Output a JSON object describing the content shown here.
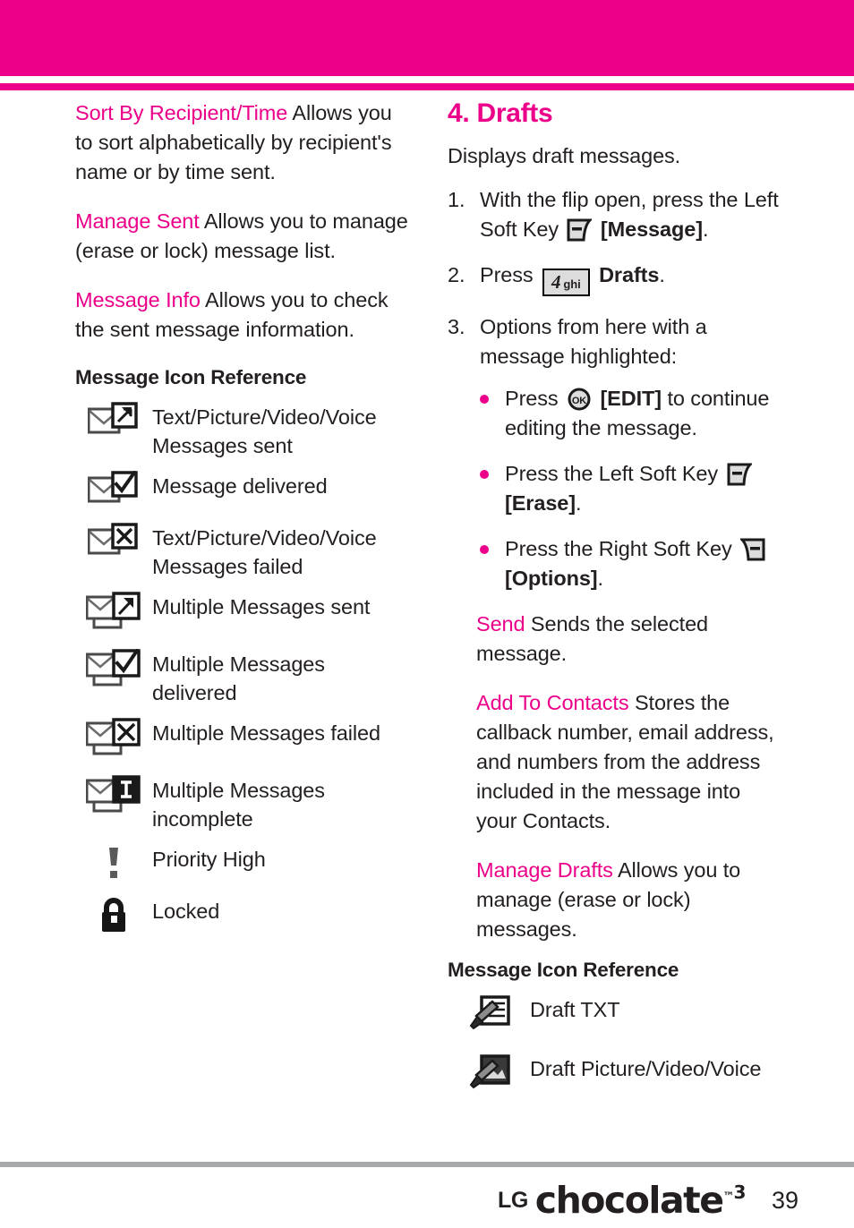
{
  "theme": {
    "accent": "#ec0089",
    "text": "#231f20",
    "rule": "#a7a9ac",
    "key_fill": "#dcdcdc"
  },
  "header": {
    "band": "magenta-band",
    "stripe": "magenta-stripe"
  },
  "left_column": {
    "paragraphs": [
      {
        "term": "Sort By Recipient/Time",
        "body": "Allows you to sort alphabetically by recipient's name or by time sent."
      },
      {
        "term": "Manage Sent",
        "body": "Allows you to manage (erase or lock) message list."
      },
      {
        "term": "Message Info",
        "body": "Allows you to check the sent message information."
      }
    ],
    "icon_reference": {
      "title": "Message Icon Reference",
      "items": [
        {
          "icon": "message-sent-icon",
          "label": "Text/Picture/Video/Voice Messages sent"
        },
        {
          "icon": "message-delivered-icon",
          "label": "Message delivered"
        },
        {
          "icon": "message-failed-icon",
          "label": "Text/Picture/Video/Voice Messages failed"
        },
        {
          "icon": "multiple-messages-sent-icon",
          "label": "Multiple Messages sent"
        },
        {
          "icon": "multiple-messages-delivered-icon",
          "label": "Multiple Messages delivered"
        },
        {
          "icon": "multiple-messages-failed-icon",
          "label": "Multiple Messages failed"
        },
        {
          "icon": "multiple-messages-incomplete-icon",
          "label": "Multiple Messages incomplete"
        },
        {
          "icon": "priority-high-icon",
          "label": "Priority High"
        },
        {
          "icon": "locked-icon",
          "label": "Locked"
        }
      ]
    }
  },
  "right_column": {
    "chapter_title": "4. Drafts",
    "intro": "Displays draft messages.",
    "steps": [
      {
        "num": "1.",
        "pre": "With the flip open, press the Left Soft Key",
        "key_icon": "left-soft-key-icon",
        "post": "[Message]",
        "post_tail": "."
      },
      {
        "num": "2.",
        "pre": "Press",
        "key_icon": "numeric-key-4-ghi",
        "key_digit": "4",
        "key_sub": "ghi",
        "post": "Drafts",
        "post_tail": "."
      },
      {
        "num": "3.",
        "pre": "Options from here with a message highlighted:",
        "key_icon": "",
        "post": "",
        "post_tail": ""
      }
    ],
    "bullets": [
      {
        "pre": "Press",
        "key_icon": "ok-key-icon",
        "mid": "[EDIT]",
        "post": "to continue editing the message."
      },
      {
        "pre": "Press the Left Soft Key",
        "key_icon": "left-soft-key-icon",
        "mid": "[Erase]",
        "post": "."
      },
      {
        "pre": "Press the Right Soft Key",
        "key_icon": "right-soft-key-icon",
        "mid": "[Options]",
        "post": "."
      }
    ],
    "options": [
      {
        "term": "Send",
        "body": "Sends the selected message."
      },
      {
        "term": "Add To Contacts",
        "body": "Stores the callback number, email address, and numbers from the address included in the message into your Contacts."
      },
      {
        "term": "Manage Drafts",
        "body": "Allows you to manage (erase or lock) messages."
      }
    ],
    "icon_reference": {
      "title": "Message Icon Reference",
      "items": [
        {
          "icon": "draft-txt-icon",
          "label": "Draft TXT"
        },
        {
          "icon": "draft-media-icon",
          "label": "Draft Picture/Video/Voice"
        }
      ]
    }
  },
  "footer": {
    "brand_lg": "LG",
    "brand_product": "chocolate",
    "brand_tm": "™",
    "brand_version": "3",
    "page_number": "39"
  }
}
